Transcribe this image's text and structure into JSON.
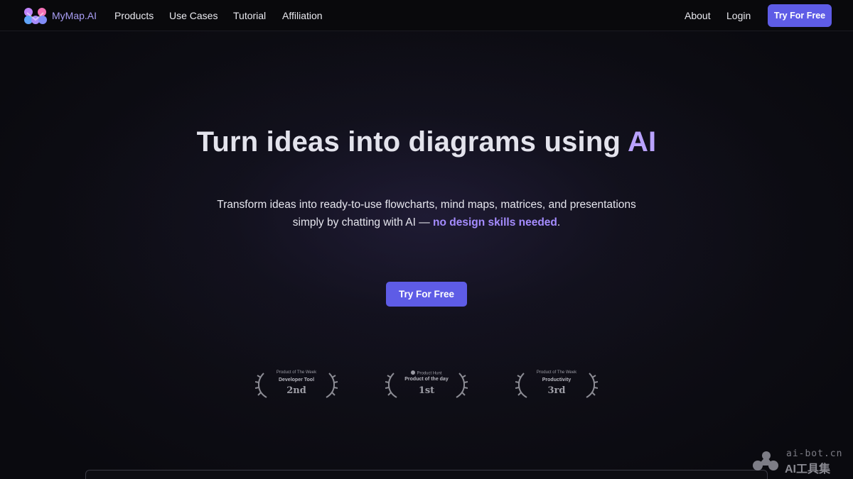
{
  "nav": {
    "brand": "MyMap.AI",
    "links": [
      "Products",
      "Use Cases",
      "Tutorial",
      "Affiliation"
    ],
    "right_links": [
      "About",
      "Login"
    ],
    "cta": "Try For Free"
  },
  "hero": {
    "title_main": "Turn ideas into diagrams using ",
    "title_accent": "AI",
    "subtitle_line1": "Transform ideas into ready-to-use flowcharts, mind maps, matrices, and presentations",
    "subtitle_line2_pre": "simply by chatting with AI — ",
    "subtitle_highlight": "no design skills needed",
    "subtitle_end": ".",
    "cta": "Try For Free"
  },
  "badges": [
    {
      "top": "Product of The Week",
      "mid": "Developer Tool",
      "rank": "2nd"
    },
    {
      "top": "Product Hunt",
      "mid": "Product of the day",
      "rank": "1st"
    },
    {
      "top": "Product of The Week",
      "mid": "Productivity",
      "rank": "3rd"
    }
  ],
  "watermark": {
    "top": "ai-bot.cn",
    "bottom": "AI工具集"
  },
  "colors": {
    "accent": "#5e5ce6",
    "title_accent": "#b9a2ff",
    "highlight": "#a58cff",
    "background": "#0a0a0f"
  }
}
